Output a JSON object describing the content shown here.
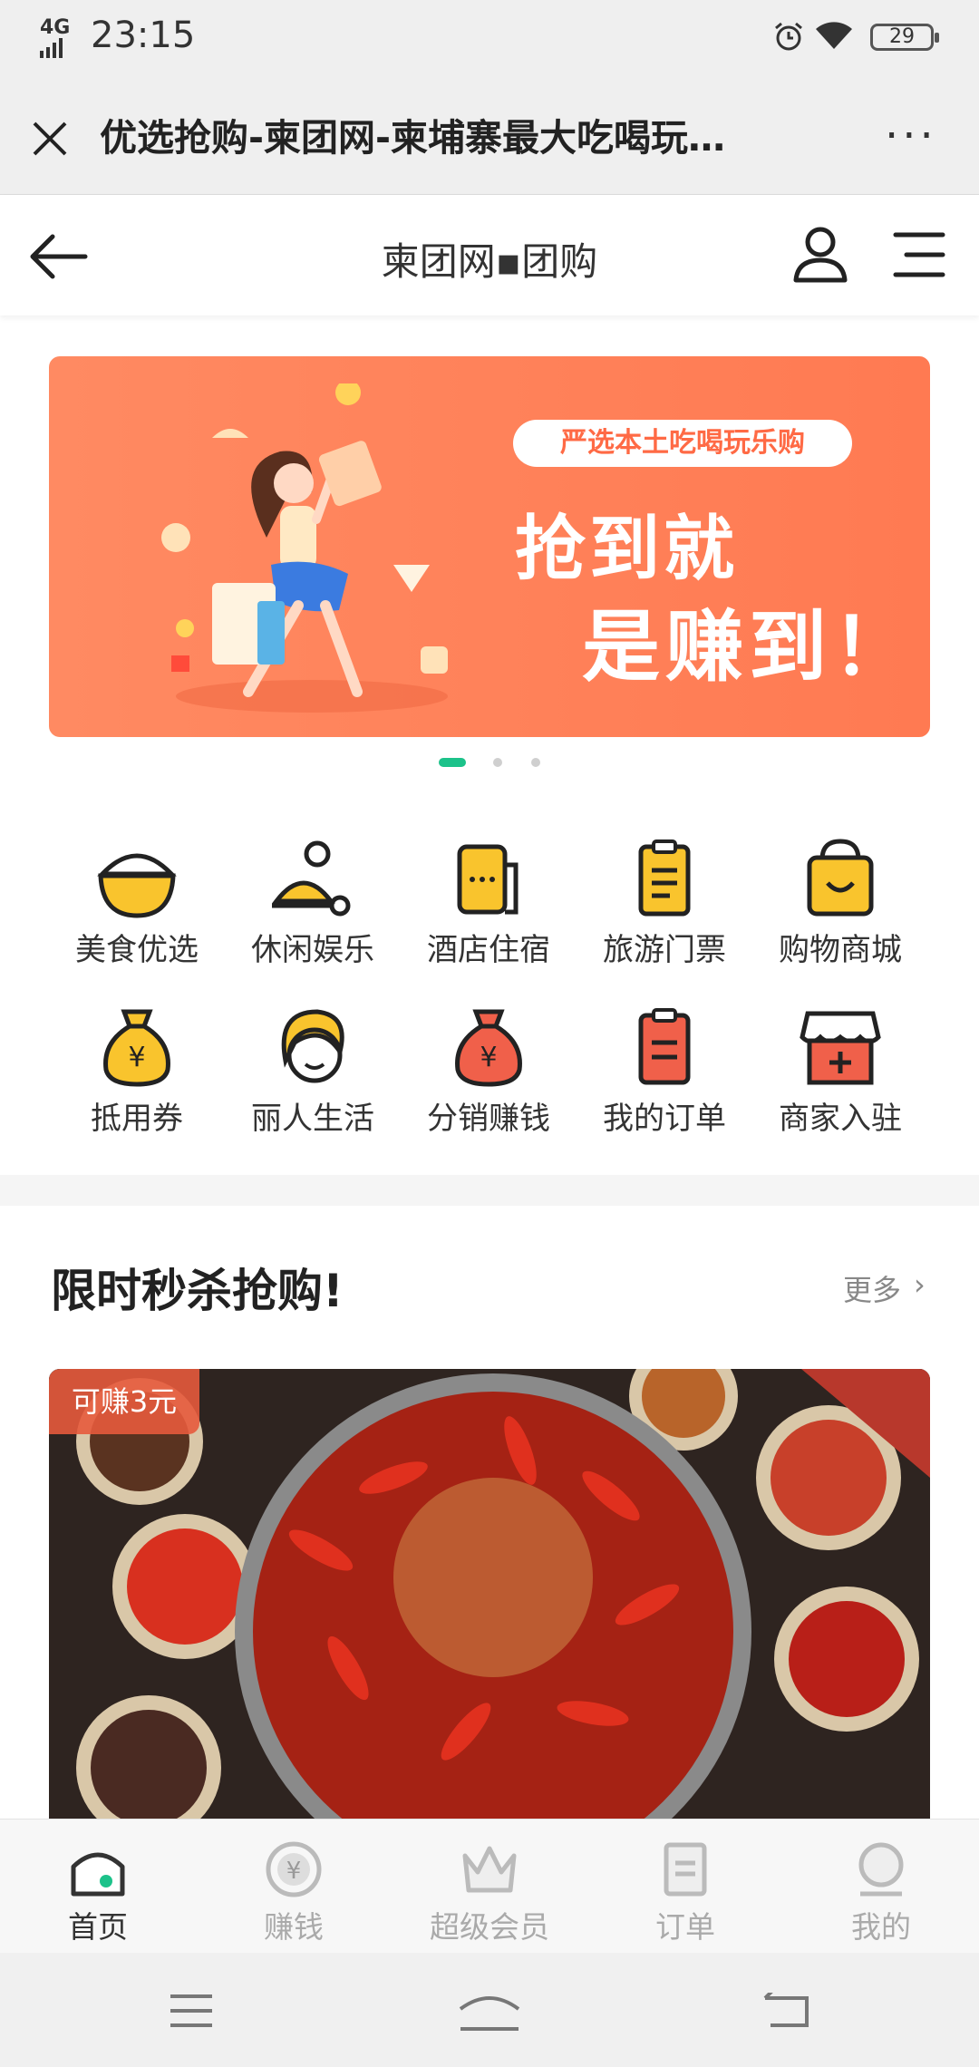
{
  "status_bar": {
    "time": "23:15",
    "network": "4G",
    "battery": "29"
  },
  "webview": {
    "title": "优选抢购-柬团网-柬埔寨最大吃喝玩…",
    "more": "···"
  },
  "site_header": {
    "title": "柬团网▪团购"
  },
  "banner": {
    "pill": "严选本土吃喝玩乐购",
    "line1": "抢到就",
    "line2": "是赚到！",
    "active_slide": 1,
    "slide_count": 3
  },
  "categories": [
    {
      "label": "美食优选",
      "icon": "food-bowl-icon"
    },
    {
      "label": "休闲娱乐",
      "icon": "leisure-icon"
    },
    {
      "label": "酒店住宿",
      "icon": "hotel-icon"
    },
    {
      "label": "旅游门票",
      "icon": "ticket-icon"
    },
    {
      "label": "购物商城",
      "icon": "shopping-bag-icon"
    },
    {
      "label": "抵用券",
      "icon": "coupon-bag-icon"
    },
    {
      "label": "丽人生活",
      "icon": "beauty-icon"
    },
    {
      "label": "分销赚钱",
      "icon": "money-bag-icon"
    },
    {
      "label": "我的订单",
      "icon": "order-clipboard-icon"
    },
    {
      "label": "商家入驻",
      "icon": "store-icon"
    }
  ],
  "flash_sale": {
    "title": "限时秒杀抢购!",
    "more": "更多",
    "product_badge": "可赚3元"
  },
  "tabs": [
    {
      "label": "首页",
      "icon": "home-icon",
      "active": true
    },
    {
      "label": "赚钱",
      "icon": "yen-coin-icon",
      "active": false
    },
    {
      "label": "超级会员",
      "icon": "crown-icon",
      "active": false
    },
    {
      "label": "订单",
      "icon": "order-icon",
      "active": false
    },
    {
      "label": "我的",
      "icon": "profile-icon",
      "active": false
    }
  ],
  "colors": {
    "accent_green": "#1cc28a",
    "banner_orange": "#ff7a52",
    "icon_yellow": "#f9c42d",
    "icon_red": "#f0604a"
  }
}
